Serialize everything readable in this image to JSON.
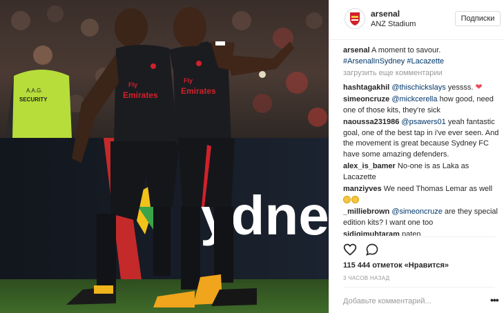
{
  "post": {
    "username": "arsenal",
    "location": "ANZ Stadium",
    "follow_label": "Подписки",
    "caption_user": "arsenal",
    "caption_text": "A moment to savour.",
    "caption_tags": "#ArsenalInSydney #Lacazette",
    "load_more": "загрузить еще комментарии",
    "likes": "115 444 отметок «Нравится»",
    "time": "3 ЧАСОВ НАЗАД",
    "add_comment_placeholder": "Добавьте комментарий...",
    "more_icon": "•••"
  },
  "comments": [
    {
      "user": "hashtagakhil",
      "mention": "@thischickslays",
      "text": "yessss."
    },
    {
      "user": "simeoncruze",
      "mention": "@mickcerella",
      "text": "how good, need one of those kits, they're sick"
    },
    {
      "user": "naoussa231986",
      "mention": "@psawers01",
      "text": "yeah fantastic goal, one of the best tap in i've ever seen. And the movement is great because Sydney FC have some amazing defenders."
    },
    {
      "user": "alex_is_bamer",
      "text": "No-one is as Laka as Lacazette"
    },
    {
      "user": "manziyves",
      "text": "We need Thomas Lemar as well"
    },
    {
      "user": "_milliebrown",
      "mention": "@simeoncruze",
      "text": "are they special edition kits? I want one too"
    },
    {
      "user": "sidiqimuhtaram",
      "text": "paten"
    }
  ],
  "photo": {
    "sponsor_left": "Fly",
    "sponsor_right": "Emirates",
    "security_line1": "A.A.G.",
    "security_line2": "SECURITY",
    "board_text": "ydne"
  },
  "colors": {
    "text": "#262626",
    "muted": "#999999",
    "link": "#003569",
    "heart": "#ed4956",
    "kit": "#1b1c20",
    "kit_trim": "#d1212a"
  }
}
